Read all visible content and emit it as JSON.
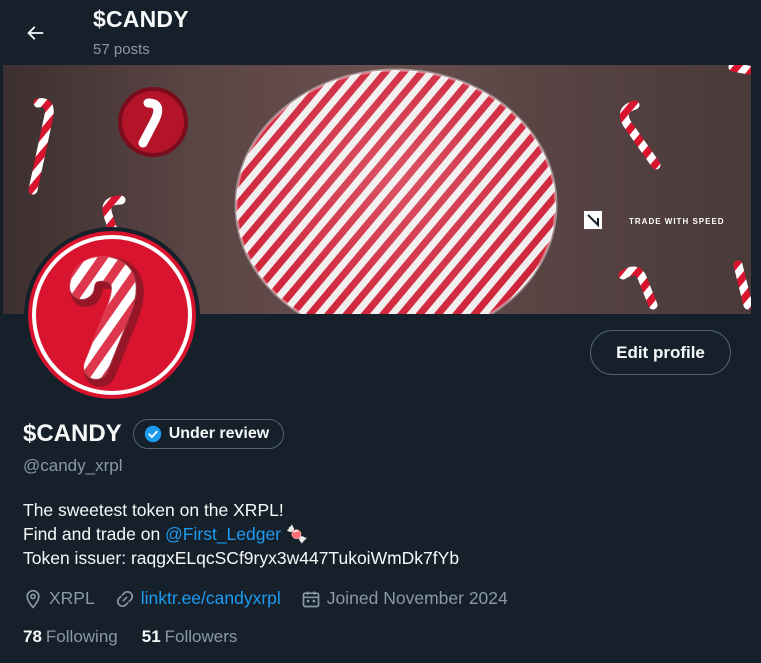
{
  "header": {
    "title": "$CANDY",
    "posts_count": "57 posts",
    "back_icon": "arrow-left-icon"
  },
  "banner": {
    "tagline": "TRADE WITH SPEED",
    "accent_red": "#d9142e",
    "accent_white": "#ffffff"
  },
  "profile": {
    "display_name": "$CANDY",
    "badge_label": "Under review",
    "handle": "@candy_xrpl",
    "edit_label": "Edit profile",
    "bio_line1": "The sweetest token on the XRPL!",
    "bio_line2_prefix": "Find and trade on ",
    "bio_line2_mention": "@First_Ledger",
    "bio_line2_emoji": "🍬",
    "bio_line3": "Token issuer: raqgxELqcSCf9ryx3w447TukoiWmDk7fYb",
    "location": "XRPL",
    "website": "linktr.ee/candyxrpl",
    "joined": "Joined November 2024",
    "following_count": "78",
    "following_label": "Following",
    "followers_count": "51",
    "followers_label": "Followers"
  },
  "colors": {
    "background": "#15202b",
    "link": "#1d9bf0",
    "muted": "#8b98a5",
    "border": "#536471"
  }
}
